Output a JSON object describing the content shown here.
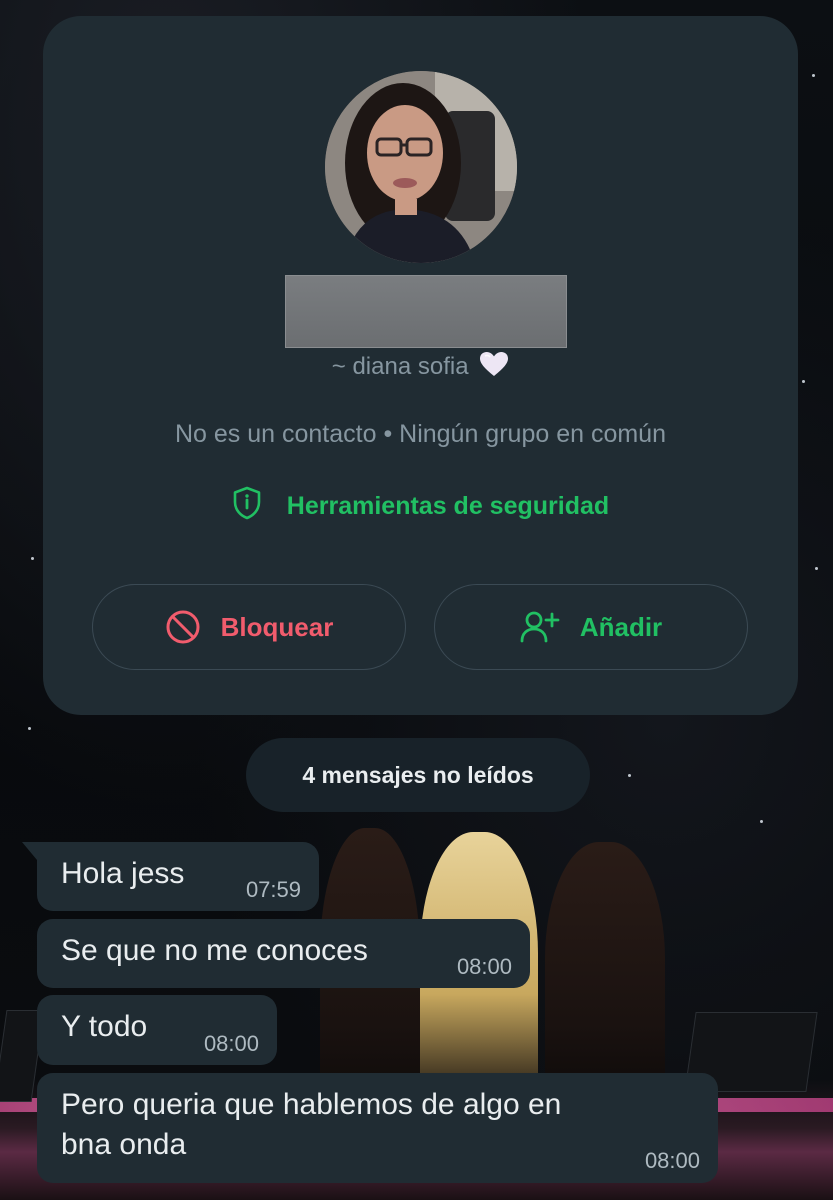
{
  "profile": {
    "username": "~ diana sofia",
    "contact_info": "No es un contacto • Ningún grupo en común",
    "security_tools_label": "Herramientas de seguridad",
    "block_label": "Bloquear",
    "add_label": "Añadir"
  },
  "chat": {
    "unread_label": "4 mensajes no leídos",
    "messages": [
      {
        "text": "Hola jess",
        "time": "07:59"
      },
      {
        "text": "Se que no me conoces",
        "time": "08:00"
      },
      {
        "text": "Y todo",
        "time": "08:00"
      },
      {
        "text": "Pero queria que hablemos de algo en\nbna onda",
        "time": "08:00"
      }
    ]
  },
  "colors": {
    "card_bg": "#202c33",
    "accent_green": "#21c063",
    "danger_red": "#f15c6d",
    "secondary_text": "#8696a0"
  },
  "icons": {
    "heart": "white-heart-icon",
    "shield": "shield-icon",
    "block": "block-icon",
    "add_person": "add-person-icon"
  }
}
